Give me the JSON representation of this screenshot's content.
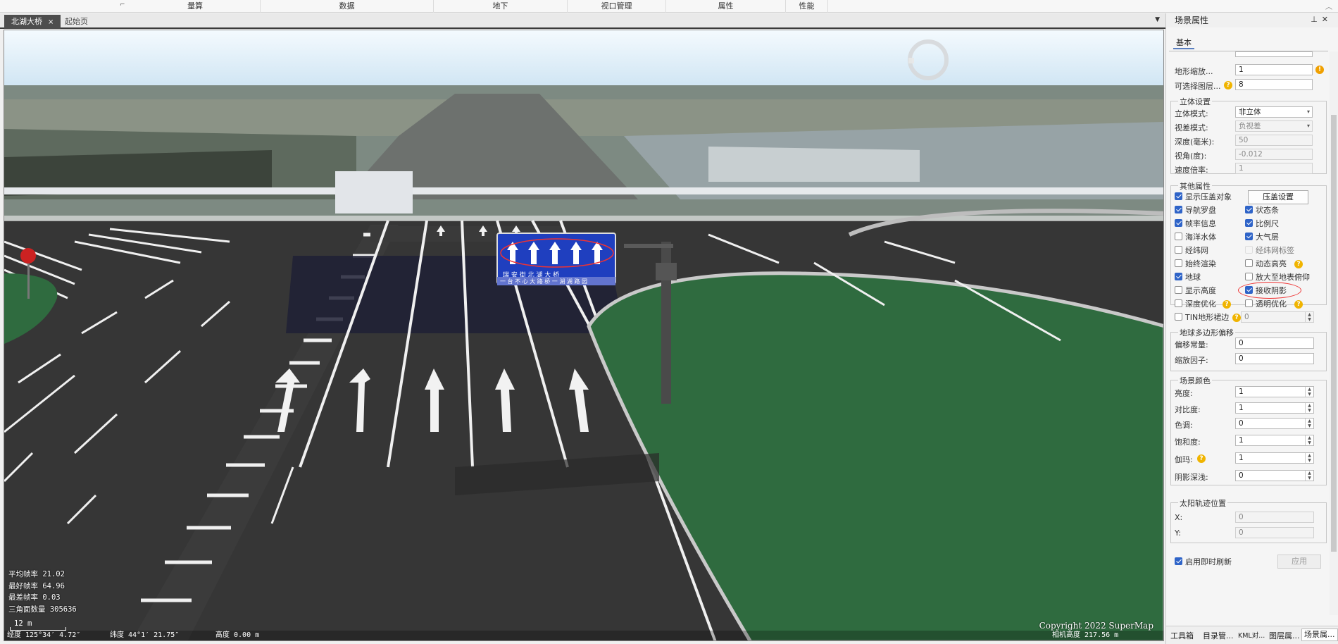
{
  "ribbon": {
    "tabs": [
      "量算",
      "数据",
      "地下",
      "视口管理",
      "属性",
      "性能"
    ]
  },
  "doc_tabs": [
    {
      "label": "北湖大桥",
      "active": true,
      "close": "×"
    },
    {
      "label": "起始页",
      "active": false
    }
  ],
  "viewport": {
    "sign_top": "向左转  向左转  直行  直行  直行  直行",
    "sign_bottom_1": "瑞 安 街    北 湖 大 桥",
    "sign_bottom_2": "一 台 不 心 大 路 桥 一 湖 湖 路 园",
    "stats": {
      "avg_fps_label": "平均帧率",
      "avg_fps": "21.02",
      "best_fps_label": "最好帧率",
      "best_fps": "64.96",
      "worst_fps_label": "最差帧率",
      "worst_fps": "0.03",
      "tri_label": "三角面数量",
      "tri": "305636"
    },
    "scale": "12 m",
    "copyright": "Copyright 2022 SuperMap",
    "status": {
      "lon": "经度 125°34′ 4.72″",
      "lat": "纬度 44°1′ 21.75″",
      "height": "高度 0.00 m",
      "cam": "相机高度 217.56 m"
    }
  },
  "panel": {
    "title": "场景属性",
    "pin_icon": "pin-icon",
    "subtab": "基本",
    "terrain_scale_label": "地形缩放...",
    "terrain_scale_value": "1",
    "selectable_layers_label": "可选择图层...",
    "selectable_layers_value": "8",
    "stereo": {
      "title": "立体设置",
      "mode_label": "立体模式:",
      "mode_value": "非立体",
      "parallax_label": "视差模式:",
      "parallax_value": "负视差",
      "depth_label": "深度(毫米):",
      "depth_value": "50",
      "angle_label": "视角(度):",
      "angle_value": "-0.012",
      "speed_label": "速度倍率:",
      "speed_value": "1"
    },
    "other": {
      "title": "其他属性",
      "show_cover_label": "显示压盖对象",
      "cover_settings_button": "压盖设置",
      "items": [
        {
          "label": "导航罗盘",
          "checked": true
        },
        {
          "label": "状态条",
          "checked": true
        },
        {
          "label": "帧率信息",
          "checked": true
        },
        {
          "label": "比例尺",
          "checked": true
        },
        {
          "label": "海洋水体",
          "checked": false
        },
        {
          "label": "大气层",
          "checked": true
        },
        {
          "label": "经纬网",
          "checked": false
        },
        {
          "label": "经纬网标签",
          "checked": false
        },
        {
          "label": "始终渲染",
          "checked": false
        },
        {
          "label": "动态高亮",
          "checked": false
        },
        {
          "label": "地球",
          "checked": true
        },
        {
          "label": "放大至地表俯仰",
          "checked": false
        },
        {
          "label": "显示高度",
          "checked": false
        },
        {
          "label": "接收阴影",
          "checked": true
        },
        {
          "label": "深度优化",
          "checked": false
        },
        {
          "label": "透明优化",
          "checked": false
        }
      ],
      "tin_label": "TIN地形裙边",
      "tin_value": "0"
    },
    "polygon_offset": {
      "title": "地球多边形偏移",
      "offset_label": "偏移常量:",
      "offset_value": "0",
      "factor_label": "缩放因子:",
      "factor_value": "0"
    },
    "scene_color": {
      "title": "场景颜色",
      "brightness_label": "亮度:",
      "brightness_value": "1",
      "contrast_label": "对比度:",
      "contrast_value": "1",
      "hue_label": "色调:",
      "hue_value": "0",
      "saturation_label": "饱和度:",
      "saturation_value": "1",
      "gamma_label": "伽玛:",
      "gamma_value": "1",
      "shadow_label": "阴影深浅:",
      "shadow_value": "0"
    },
    "sun": {
      "title": "太阳轨迹位置",
      "x_label": "X:",
      "x_value": "0",
      "y_label": "Y:",
      "y_value": "0"
    },
    "realtime_refresh_label": "启用即时刷新",
    "apply_button": "应用",
    "bottom_tabs": [
      "工具箱",
      "目录管...",
      "KML对...",
      "图层属...",
      "场景属..."
    ]
  },
  "colors": {
    "accent": "#2f64c8",
    "sign_blue": "#1f3fbf",
    "grass": "#2f6b3f",
    "asphalt": "#363636"
  }
}
